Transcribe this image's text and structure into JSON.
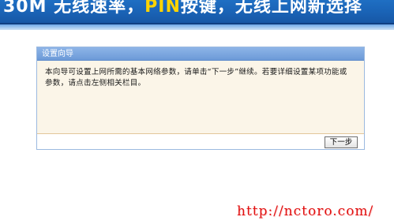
{
  "banner": {
    "title_part1": "30M 无线速率，",
    "title_highlight": "PIN",
    "title_part2": "按键，无线上网新选择"
  },
  "wizard": {
    "header": "设置向导",
    "message": "本向导可设置上网所需的基本网络参数，请单击“下一步”继续。若要详细设置某项功能或参数，请点击左侧相关栏目。",
    "next_label": "下一步"
  },
  "watermark": {
    "text": "http://nctoro.com/"
  }
}
